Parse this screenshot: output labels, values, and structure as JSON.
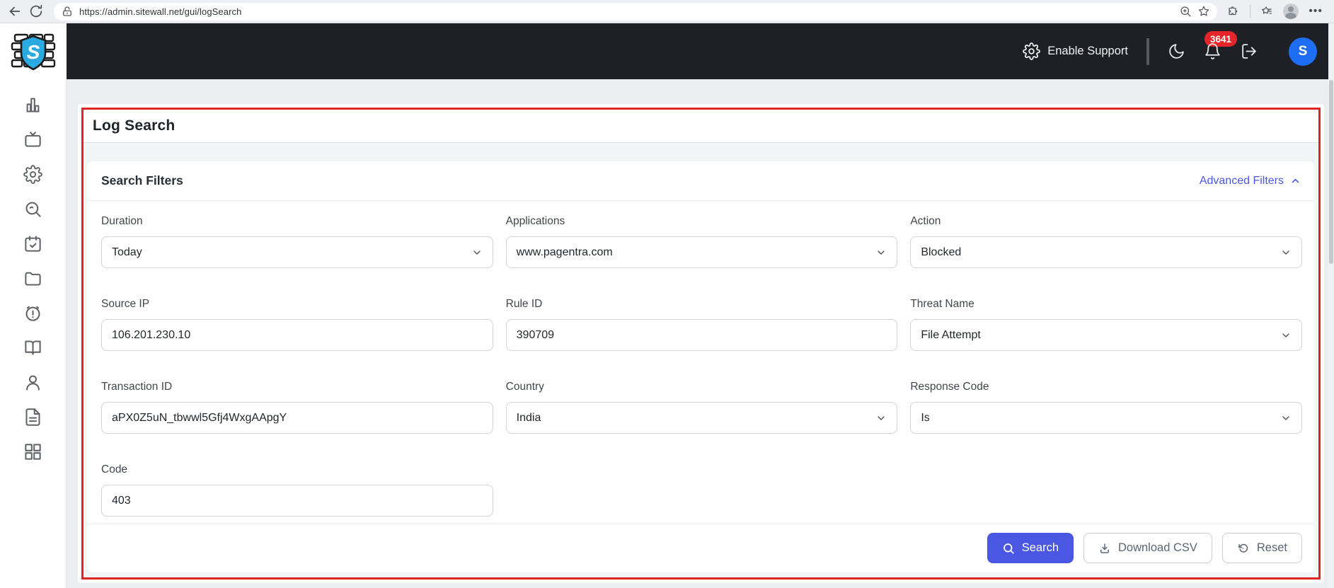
{
  "browser": {
    "url": "https://admin.sitewall.net/gui/logSearch"
  },
  "header": {
    "enable_support": "Enable Support",
    "notification_count": "3641",
    "avatar_initial": "S",
    "logo_letter": "S"
  },
  "page": {
    "title": "Log Search"
  },
  "filters": {
    "title": "Search Filters",
    "advanced_toggle": "Advanced Filters",
    "fields": [
      {
        "label": "Duration",
        "value": "Today",
        "type": "select"
      },
      {
        "label": "Applications",
        "value": "www.pagentra.com",
        "type": "select"
      },
      {
        "label": "Action",
        "value": "Blocked",
        "type": "select"
      },
      {
        "label": "Source IP",
        "value": "106.201.230.10",
        "type": "text"
      },
      {
        "label": "Rule ID",
        "value": "390709",
        "type": "text"
      },
      {
        "label": "Threat Name",
        "value": "File Attempt",
        "type": "select"
      },
      {
        "label": "Transaction ID",
        "value": "aPX0Z5uN_tbwwl5Gfj4WxgAApgY",
        "type": "text"
      },
      {
        "label": "Country",
        "value": "India",
        "type": "select"
      },
      {
        "label": "Response Code",
        "value": "Is",
        "type": "select"
      },
      {
        "label": "Code",
        "value": "403",
        "type": "text"
      }
    ],
    "actions": {
      "search": "Search",
      "download": "Download CSV",
      "reset": "Reset"
    }
  },
  "colors": {
    "accent": "#4a57e3",
    "header_bg": "#1d2126",
    "badge_red": "#e5252a",
    "highlight_border": "#e02424",
    "avatar_blue": "#1e6ef5",
    "logo_shield_blue": "#29abe2"
  }
}
